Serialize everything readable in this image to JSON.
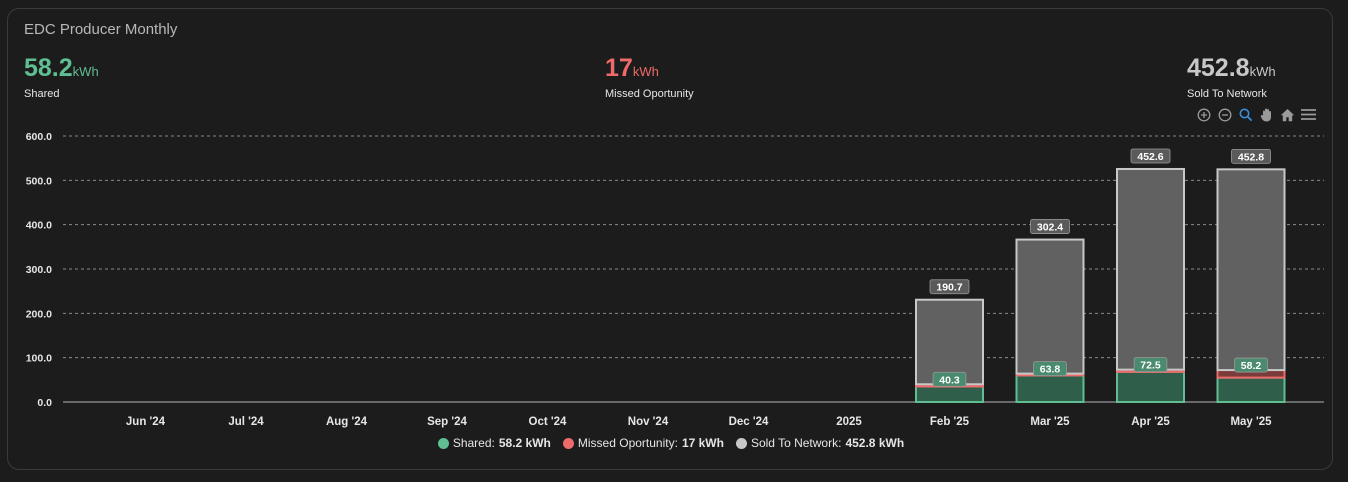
{
  "card": {
    "title": "EDC Producer Monthly"
  },
  "stats": [
    {
      "value": "58.2",
      "unit": "kWh",
      "label": "Shared",
      "color": "#5fbf93"
    },
    {
      "value": "17",
      "unit": "kWh",
      "label": "Missed Oportunity",
      "color": "#ef6a6a"
    },
    {
      "value": "452.8",
      "unit": "kWh",
      "label": "Sold To Network",
      "color": "#c8c8c8"
    }
  ],
  "toolbar": [
    "zoom-in-icon",
    "zoom-out-icon",
    "selection-zoom-icon",
    "pan-hand-icon",
    "home-reset-icon",
    "menu-icon"
  ],
  "legend": [
    {
      "label": "Shared:",
      "value": "58.2 kWh",
      "color": "#5fbf93"
    },
    {
      "label": "Missed Oportunity:",
      "value": "17 kWh",
      "color": "#ef6a6a"
    },
    {
      "label": "Sold To Network:",
      "value": "452.8 kWh",
      "color": "#c8c8c8"
    }
  ],
  "chart_data": {
    "type": "bar",
    "stacked": true,
    "categories": [
      "Jun '24",
      "Jul '24",
      "Aug '24",
      "Sep '24",
      "Oct '24",
      "Nov '24",
      "Dec '24",
      "2025",
      "Feb '25",
      "Mar '25",
      "Apr '25",
      "May '25"
    ],
    "series": [
      {
        "name": "Shared",
        "color": "#5fbf93",
        "values": [
          null,
          null,
          null,
          null,
          null,
          null,
          null,
          null,
          35,
          60,
          68,
          55
        ]
      },
      {
        "name": "Missed Oportunity",
        "color": "#ef6a6a",
        "values": [
          null,
          null,
          null,
          null,
          null,
          null,
          null,
          null,
          5,
          4,
          5,
          17
        ]
      },
      {
        "name": "Sold To Network",
        "color": "#c8c8c8",
        "values": [
          null,
          null,
          null,
          null,
          null,
          null,
          null,
          null,
          190.7,
          302.4,
          452.6,
          452.8
        ]
      }
    ],
    "data_labels": [
      {
        "index": 8,
        "inner": "40.3",
        "top": "190.7"
      },
      {
        "index": 9,
        "inner": "63.8",
        "top": "302.4"
      },
      {
        "index": 10,
        "inner": "72.5",
        "top": "452.6"
      },
      {
        "index": 11,
        "inner": "58.2",
        "top": "452.8"
      }
    ],
    "yticks": [
      "0.0",
      "100.0",
      "200.0",
      "300.0",
      "400.0",
      "500.0",
      "600.0"
    ],
    "ylim": [
      0,
      600
    ],
    "grid": true,
    "legend_position": "bottom"
  }
}
